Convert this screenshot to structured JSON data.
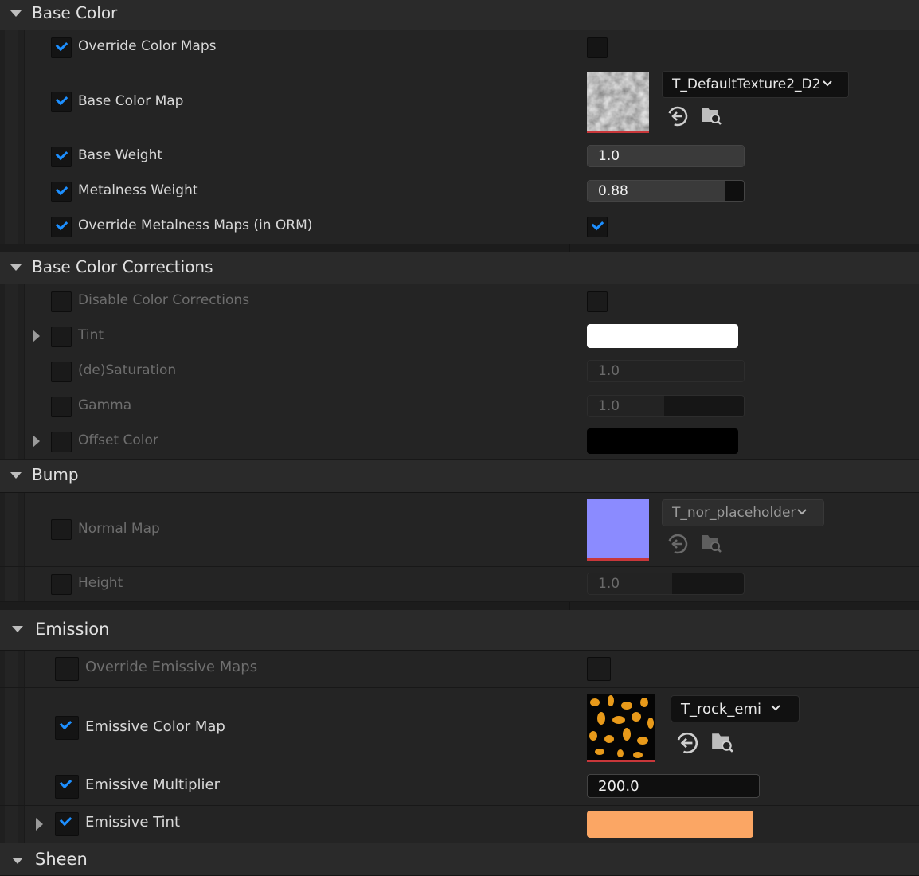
{
  "sections": {
    "base_color": {
      "label": "Base Color"
    },
    "base_color_corrections": {
      "label": "Base Color Corrections"
    },
    "bump": {
      "label": "Bump"
    },
    "emission": {
      "label": "Emission"
    },
    "sheen": {
      "label": "Sheen"
    }
  },
  "base_color": {
    "override_color_maps": {
      "label": "Override Color Maps",
      "enabled": true,
      "value": false
    },
    "base_color_map": {
      "label": "Base Color Map",
      "enabled": true,
      "texture": "T_DefaultTexture2_D2"
    },
    "base_weight": {
      "label": "Base Weight",
      "enabled": true,
      "value": "1.0",
      "fill": 1.0
    },
    "metalness_weight": {
      "label": "Metalness Weight",
      "enabled": true,
      "value": "0.88",
      "fill": 0.88
    },
    "override_metalness_maps": {
      "label": "Override Metalness Maps (in ORM)",
      "enabled": true,
      "value": true
    }
  },
  "corrections": {
    "disable_color_corrections": {
      "label": "Disable Color Corrections",
      "enabled": false,
      "value": false
    },
    "tint": {
      "label": "Tint",
      "enabled": false,
      "color": "#ffffff"
    },
    "desaturation": {
      "label": "(de)Saturation",
      "enabled": false,
      "value": "1.0"
    },
    "gamma": {
      "label": "Gamma",
      "enabled": false,
      "value": "1.0"
    },
    "offset_color": {
      "label": "Offset Color",
      "enabled": false,
      "color": "#000000"
    }
  },
  "bump": {
    "normal_map": {
      "label": "Normal Map",
      "enabled": false,
      "texture": "T_nor_placeholder",
      "color": "#8b8bff"
    },
    "height": {
      "label": "Height",
      "enabled": false,
      "value": "1.0"
    }
  },
  "emission": {
    "override_emissive_maps": {
      "label": "Override Emissive Maps",
      "enabled": false,
      "value": false
    },
    "emissive_color_map": {
      "label": "Emissive Color Map",
      "enabled": true,
      "texture": "T_rock_emi"
    },
    "emissive_multiplier": {
      "label": "Emissive Multiplier",
      "enabled": true,
      "value": "200.0"
    },
    "emissive_tint": {
      "label": "Emissive Tint",
      "enabled": true,
      "color": "#fba664"
    }
  },
  "icons": {
    "use_selected": "arrow-left-circle-icon",
    "browse": "folder-search-icon"
  }
}
